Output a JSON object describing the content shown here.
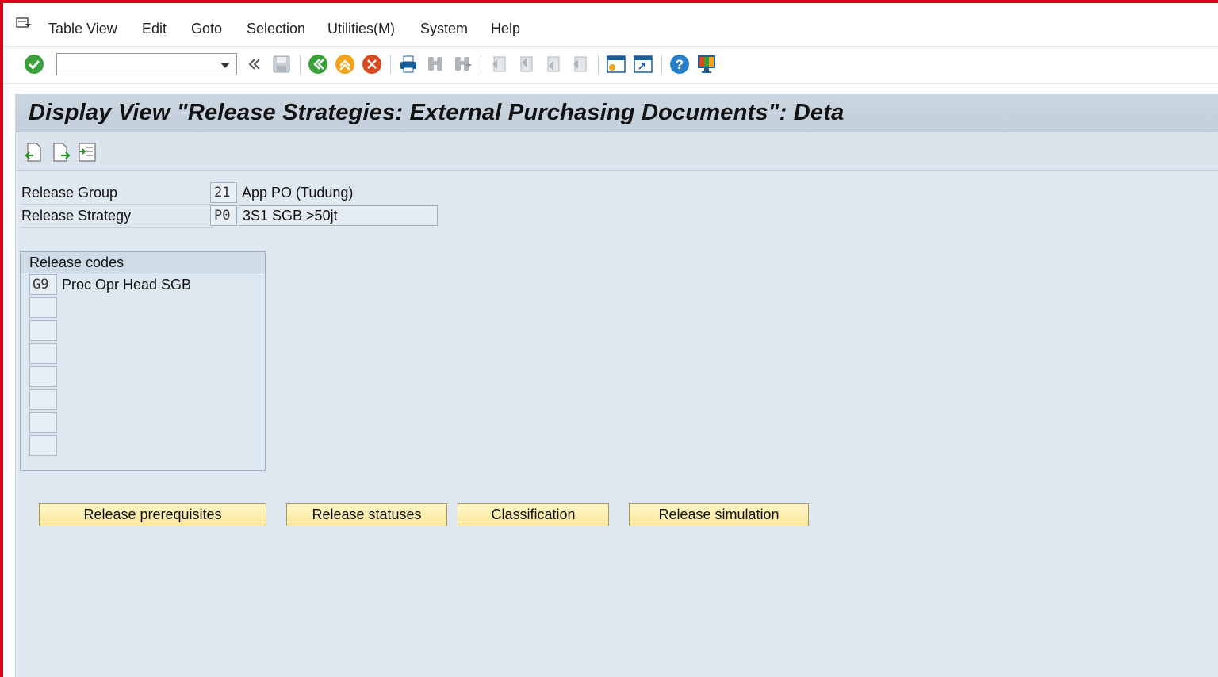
{
  "menu": {
    "items": [
      "Table View",
      "Edit",
      "Goto",
      "Selection",
      "Utilities(M)",
      "System",
      "Help"
    ]
  },
  "toolbar": {
    "command_field_value": "",
    "icons": [
      "enter-icon",
      "command-dropdown",
      "collapse-icon",
      "save-icon",
      "back-icon",
      "exit-icon",
      "cancel-icon",
      "print-icon",
      "find-icon",
      "find-next-icon",
      "first-page-icon",
      "previous-page-icon",
      "next-page-icon",
      "last-page-icon",
      "create-session-icon",
      "shortcut-icon",
      "help-icon",
      "customize-layout-icon"
    ]
  },
  "page": {
    "title": "Display View \"Release Strategies: External Purchasing Documents\": Deta"
  },
  "fields": {
    "release_group": {
      "label": "Release Group",
      "key": "21",
      "text": "App PO (Tudung)"
    },
    "release_strategy": {
      "label": "Release Strategy",
      "key": "P0",
      "text": "3S1 SGB >50jt"
    }
  },
  "release_codes": {
    "title": "Release codes",
    "rows": [
      {
        "code": "G9",
        "desc": "Proc Opr Head SGB"
      },
      {
        "code": "",
        "desc": ""
      },
      {
        "code": "",
        "desc": ""
      },
      {
        "code": "",
        "desc": ""
      },
      {
        "code": "",
        "desc": ""
      },
      {
        "code": "",
        "desc": ""
      },
      {
        "code": "",
        "desc": ""
      },
      {
        "code": "",
        "desc": ""
      }
    ]
  },
  "buttons": {
    "prerequisites": "Release prerequisites",
    "statuses": "Release statuses",
    "classification": "Classification",
    "simulation": "Release simulation"
  },
  "colors": {
    "sap_red": "#d9001b",
    "button_yellow": "#fbe89b",
    "background_blue": "#dfe8f0"
  }
}
